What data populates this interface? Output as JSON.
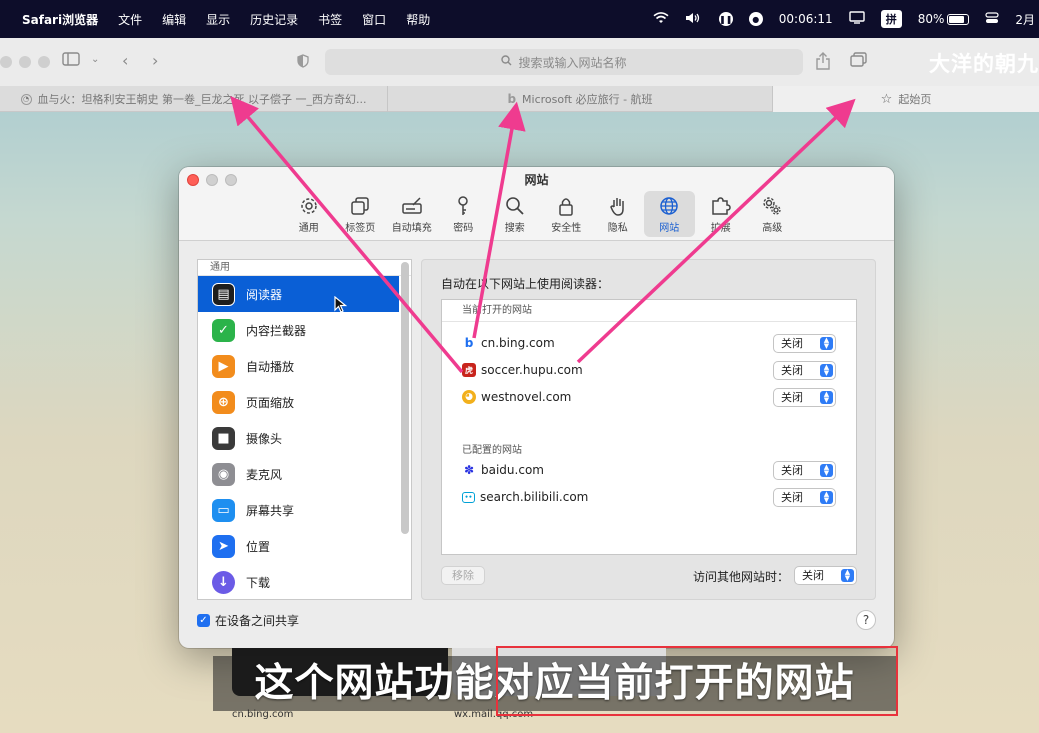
{
  "menubar": {
    "apple": "",
    "app_name": "Safari浏览器",
    "items": [
      "文件",
      "编辑",
      "显示",
      "历史记录",
      "书签",
      "窗口",
      "帮助"
    ],
    "time": "00:06:11",
    "ime": "拼",
    "battery": "80%",
    "date": "2月"
  },
  "toolbar": {
    "search_placeholder": "搜索或输入网站名称",
    "watermark": "大洋的朝九"
  },
  "tabs": [
    {
      "label": "血与火：坦格利安王朝史 第一卷_巨龙之死 以子偿子 一_西方奇幻..."
    },
    {
      "label": "Microsoft 必应旅行 - 航班"
    },
    {
      "label": "起始页"
    }
  ],
  "prefs": {
    "title": "网站",
    "tabs": [
      {
        "label": "通用",
        "icon": "gear-icon"
      },
      {
        "label": "标签页",
        "icon": "tabs-icon"
      },
      {
        "label": "自动填充",
        "icon": "autofill-icon"
      },
      {
        "label": "密码",
        "icon": "key-icon"
      },
      {
        "label": "搜索",
        "icon": "search-icon"
      },
      {
        "label": "安全性",
        "icon": "lock-icon"
      },
      {
        "label": "隐私",
        "icon": "hand-icon"
      },
      {
        "label": "网站",
        "icon": "globe-icon"
      },
      {
        "label": "扩展",
        "icon": "puzzle-icon"
      },
      {
        "label": "高级",
        "icon": "gears-icon"
      }
    ],
    "sidebar": {
      "section": "通用",
      "items": [
        {
          "label": "阅读器",
          "color": "#1e1e1e"
        },
        {
          "label": "内容拦截器",
          "color": "#2bb34a"
        },
        {
          "label": "自动播放",
          "color": "#f28c1c"
        },
        {
          "label": "页面缩放",
          "color": "#f28c1c"
        },
        {
          "label": "摄像头",
          "color": "#3a3a3a"
        },
        {
          "label": "麦克风",
          "color": "#8e8e93"
        },
        {
          "label": "屏幕共享",
          "color": "#1e8ff0"
        },
        {
          "label": "位置",
          "color": "#1e6ff0"
        },
        {
          "label": "下载",
          "color": "#6b5be6"
        }
      ]
    },
    "panel": {
      "label": "自动在以下网站上使用阅读器：",
      "current_header": "当前打开的网站",
      "current_sites": [
        {
          "name": "cn.bing.com",
          "value": "关闭"
        },
        {
          "name": "soccer.hupu.com",
          "value": "关闭"
        },
        {
          "name": "westnovel.com",
          "value": "关闭"
        }
      ],
      "configured_header": "已配置的网站",
      "configured_sites": [
        {
          "name": "baidu.com",
          "value": "关闭"
        },
        {
          "name": "search.bilibili.com",
          "value": "关闭"
        }
      ],
      "remove_label": "移除",
      "other_label": "访问其他网站时：",
      "other_value": "关闭"
    },
    "share_label": "在设备之间共享",
    "help": "?"
  },
  "thumbnails": [
    "cn.bing.com",
    "wx.mail.qq.com"
  ],
  "subtitle": "这个网站功能对应当前打开的网站"
}
